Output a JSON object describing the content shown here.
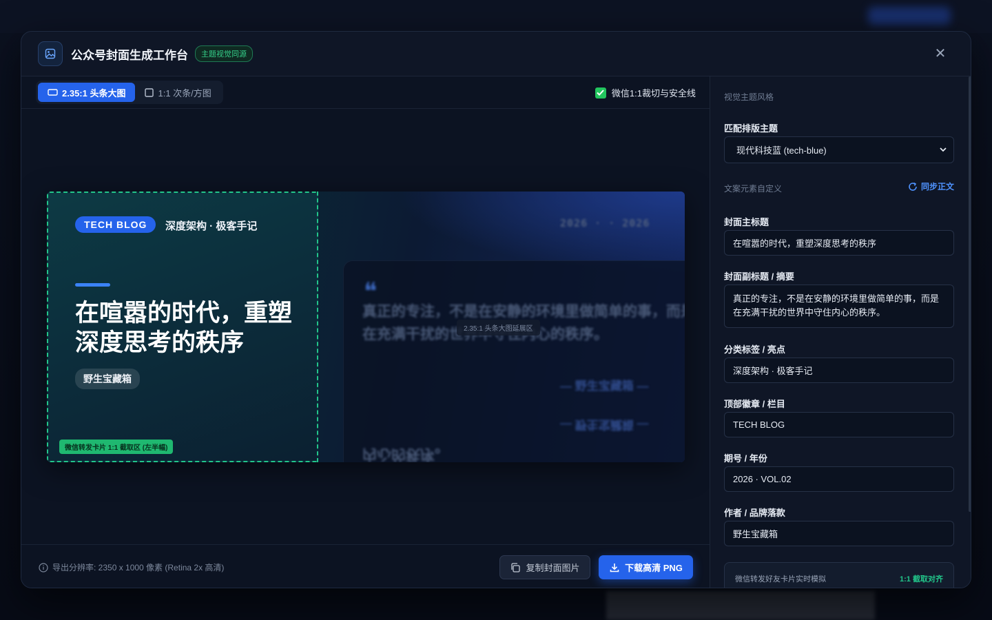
{
  "header": {
    "title": "公众号封面生成工作台",
    "badge": "主题视觉同源",
    "close": "✕"
  },
  "toolbar": {
    "tab_wide": "2.35:1 头条大图",
    "tab_square": "1:1 次条/方图",
    "safe_line": "微信1:1裁切与安全线",
    "safe_line_checked": true
  },
  "cover": {
    "badge": "TECH BLOG",
    "category": "深度架构 · 极客手记",
    "title": "在喧嚣的时代，重塑深度思考的秩序",
    "author": "野生宝藏箱",
    "crop_tag": "微信转发卡片 1:1 截取区 (左半幅)",
    "ext_tag": "2.35:1 头条大图延展区",
    "year_text": "2026 · · 2026",
    "quote_mark": "❝",
    "quote_text": "真正的专注，不是在安静的环境里做简单的事，而是在充满干扰的世界中守住内心的秩序。",
    "quote_author": "— 野生宝藏箱 —",
    "quote_author_mirror": "— 野生宝藏箱 —",
    "quote_foot": "内心的秩序。"
  },
  "footer": {
    "info": "导出分辨率: 2350 x 1000 像素 (Retina 2x 高清)",
    "copy": "复制封面图片",
    "download": "下载高清 PNG"
  },
  "panel": {
    "section_theme": "视觉主题风格",
    "theme_label": "匹配排版主题",
    "theme_value": "现代科技蓝 (tech-blue)",
    "section_elements": "文案元素自定义",
    "sync": "同步正文",
    "title_label": "封面主标题",
    "title_value": "在喧嚣的时代，重塑深度思考的秩序",
    "subtitle_label": "封面副标题 / 摘要",
    "subtitle_value": "真正的专注，不是在安静的环境里做简单的事，而是在充满干扰的世界中守住内心的秩序。",
    "tag_label": "分类标签 / 亮点",
    "tag_value": "深度架构 · 极客手记",
    "badge_label": "顶部徽章 / 栏目",
    "badge_value": "TECH BLOG",
    "issue_label": "期号 / 年份",
    "issue_value": "2026 · VOL.02",
    "author_label": "作者 / 品牌落款",
    "author_value": "野生宝藏箱",
    "sim_label": "微信转发好友卡片实时模拟",
    "sim_right": "1:1 截取对齐"
  },
  "colors": {
    "accent": "#2563eb",
    "success": "#22c58a"
  }
}
